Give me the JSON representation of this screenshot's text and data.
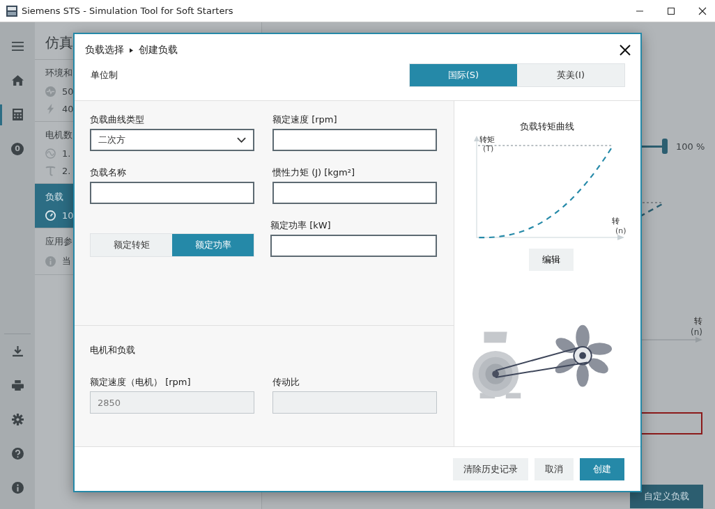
{
  "window": {
    "title": "Siemens STS - Simulation Tool for Soft Starters"
  },
  "nav": {
    "items": [
      {
        "kind": "menu",
        "selected": false
      },
      {
        "kind": "home",
        "selected": false
      },
      {
        "kind": "calculator",
        "selected": true
      },
      {
        "kind": "badge",
        "badge": "0",
        "selected": false
      }
    ],
    "bottom_items": [
      {
        "kind": "download"
      },
      {
        "kind": "print"
      },
      {
        "kind": "settings"
      },
      {
        "kind": "help"
      },
      {
        "kind": "info"
      }
    ]
  },
  "panel": {
    "title": "仿真",
    "sections": [
      {
        "title": "环境和",
        "selected": false,
        "values": [
          {
            "kind": "pulse",
            "text": "50"
          },
          {
            "kind": "bolt",
            "text": "40"
          }
        ]
      },
      {
        "title": "电机数",
        "selected": false,
        "values": [
          {
            "kind": "wave",
            "text": "1."
          },
          {
            "kind": "torque",
            "text": "2."
          }
        ]
      },
      {
        "title": "负载",
        "selected": true,
        "values": [
          {
            "kind": "gauge",
            "text": "10"
          }
        ]
      },
      {
        "title": "应用参",
        "selected": false,
        "values": [
          {
            "kind": "info",
            "text": "当"
          }
        ]
      }
    ]
  },
  "main": {
    "slider": {
      "level": 1,
      "reading": "100 %"
    },
    "axis_label": "转",
    "axis_unit": "(n)",
    "button": "自定义负载"
  },
  "dialog": {
    "breadcrumb": [
      {
        "text": "负载选择"
      },
      {
        "text": "创建负载"
      }
    ],
    "unit_label": "单位制",
    "unit_options": [
      {
        "label": "国际(S)",
        "selected": true
      },
      {
        "label": "英美(I)",
        "selected": false
      }
    ],
    "curve_type": {
      "label": "负载曲线类型",
      "value": "二次方"
    },
    "rated_speed": {
      "label": "额定速度 [rpm]"
    },
    "load_name": {
      "label": "负载名称"
    },
    "inertia": {
      "label": "惯性力矩 (J) [kgm²]"
    },
    "mode_tabs": [
      {
        "label": "额定转矩",
        "selected": false
      },
      {
        "label": "额定功率",
        "selected": true
      }
    ],
    "rated_power": {
      "label": "额定功率 [kW]"
    },
    "motor_section": {
      "title": "电机和负载",
      "motor_speed": {
        "label": "额定速度（电机） [rpm]",
        "value": "2850",
        "disabled": true
      },
      "ratio": {
        "label": "传动比",
        "disabled": true
      }
    },
    "chart": {
      "title": "负载转矩曲线",
      "y_label": "转矩",
      "y_unit": "(T)",
      "x_label": "转",
      "x_unit": "(n)",
      "edit_button": "编辑"
    },
    "buttons": [
      {
        "label": "清除历史记录",
        "kind": "secondary"
      },
      {
        "label": "取消",
        "kind": "secondary"
      },
      {
        "label": "创建",
        "kind": "primary"
      }
    ]
  }
}
